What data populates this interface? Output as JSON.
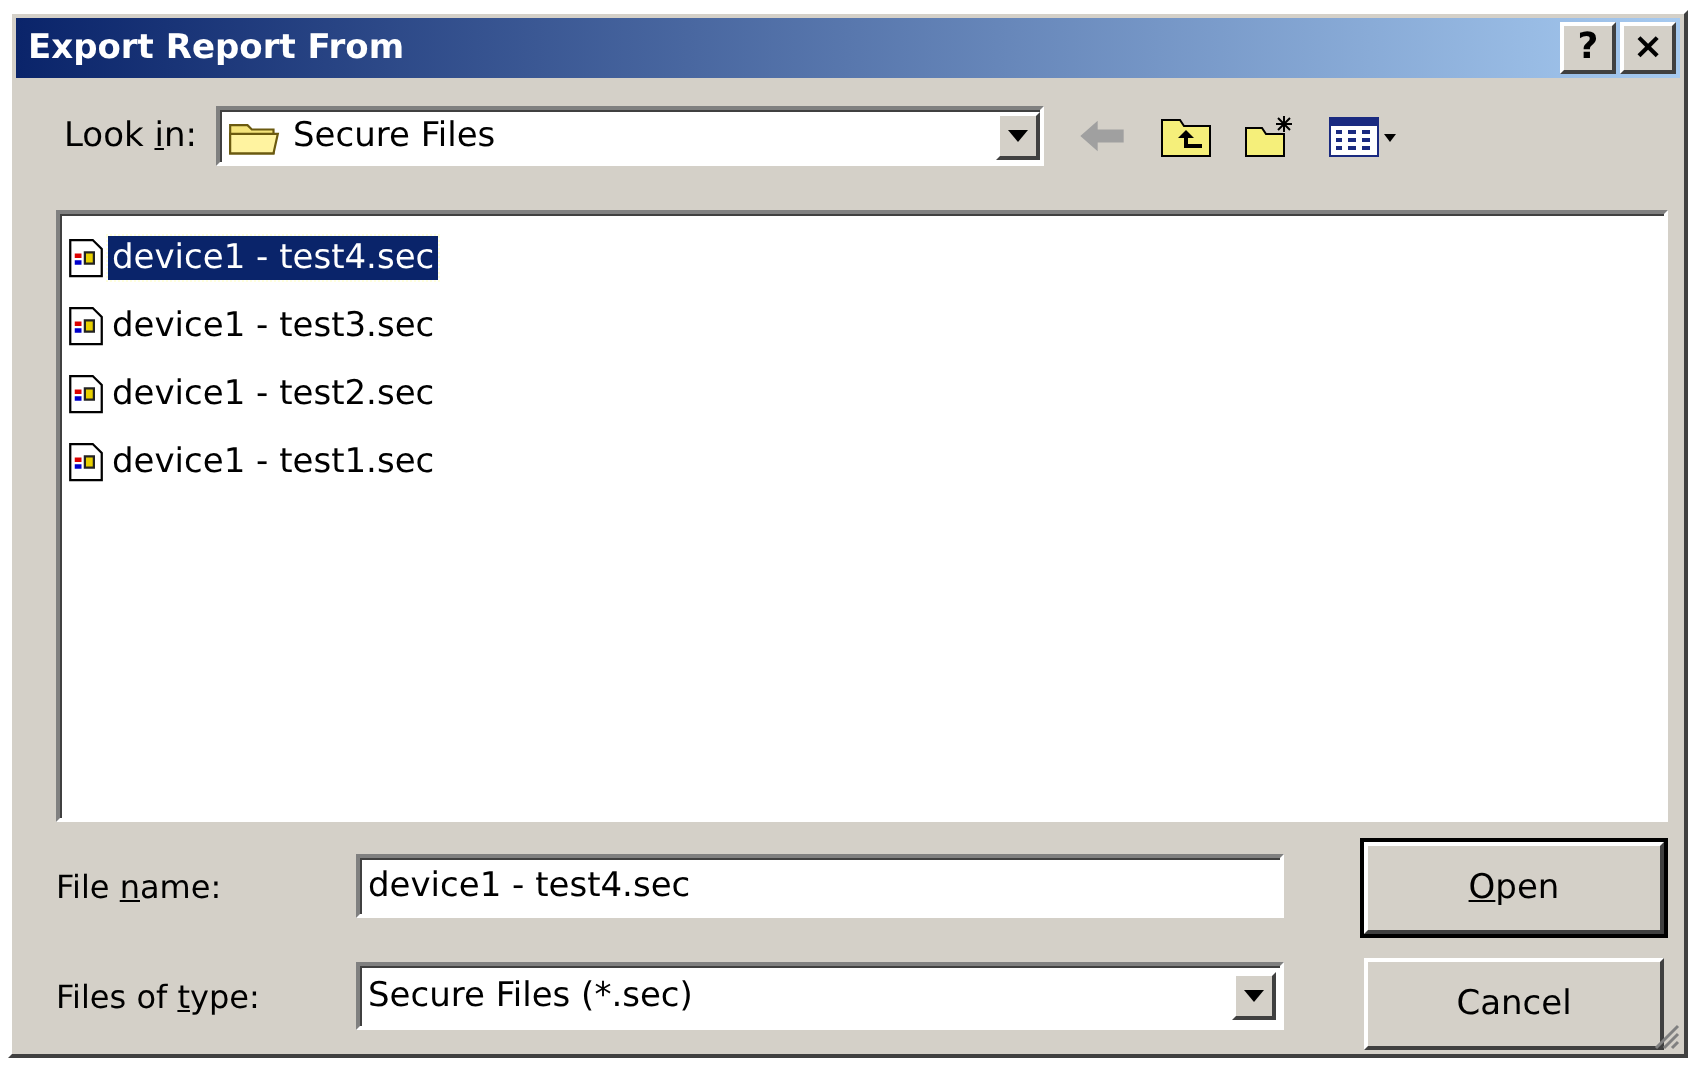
{
  "window": {
    "title": "Export Report From",
    "help_button": "?",
    "close_button": "×"
  },
  "look_in": {
    "label": {
      "before": "Look ",
      "key": "i",
      "after": "n:"
    },
    "value": "Secure Files"
  },
  "files": [
    {
      "name": "device1 - test4.sec",
      "selected": true
    },
    {
      "name": "device1 - test3.sec",
      "selected": false
    },
    {
      "name": "device1 - test2.sec",
      "selected": false
    },
    {
      "name": "device1 - test1.sec",
      "selected": false
    }
  ],
  "file_name": {
    "label": {
      "before": "File ",
      "key": "n",
      "after": "ame:"
    },
    "value": "device1 - test4.sec"
  },
  "file_type": {
    "label": {
      "before": "Files of ",
      "key": "t",
      "after": "ype:"
    },
    "value": "Secure Files (*.sec)"
  },
  "buttons": [
    {
      "label": {
        "key": "O",
        "after": "pen"
      },
      "default": true
    },
    {
      "label": {
        "before": "Cancel"
      },
      "default": false
    }
  ]
}
